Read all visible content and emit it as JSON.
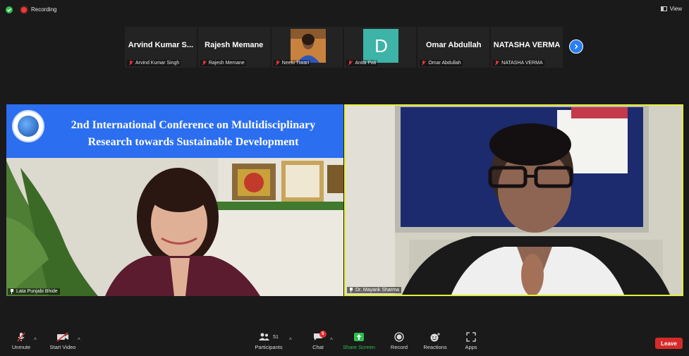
{
  "status": {
    "recording_label": "Recording",
    "view_label": "View"
  },
  "gallery": [
    {
      "display": "Arvind Kumar S...",
      "name": "Arvind Kumar Singh",
      "type": "name"
    },
    {
      "display": "Rajesh Memane",
      "name": "Rajesh Memane",
      "type": "name"
    },
    {
      "display": "",
      "name": "Neelu Tiwari",
      "type": "photo"
    },
    {
      "display": "D",
      "name": "Anita Pati",
      "type": "avatar"
    },
    {
      "display": "Omar Abdullah",
      "name": "Omar Abdullah",
      "type": "name"
    },
    {
      "display": "NATASHA VERMA",
      "name": "NATASHA VERMA",
      "type": "name"
    }
  ],
  "main_left": {
    "banner_title": "2nd International Conference on Multidisciplinary Research towards Sustainable Development",
    "name": "Lata Punjabi Bhide"
  },
  "main_right": {
    "name": "Dr. Mayank Sharma"
  },
  "toolbar": {
    "unmute": "Unmute",
    "start_video": "Start Video",
    "participants": "Participants",
    "participants_count": "51",
    "chat": "Chat",
    "chat_badge": "5",
    "share_screen": "Share Screen",
    "record": "Record",
    "reactions": "Reactions",
    "apps": "Apps",
    "leave": "Leave"
  },
  "colors": {
    "accent_blue": "#2a7ff0",
    "share_green": "#2dbf4e",
    "leave_red": "#d62a2a",
    "active_speaker": "#e5ee3b",
    "avatar_teal": "#3eb3a7"
  }
}
